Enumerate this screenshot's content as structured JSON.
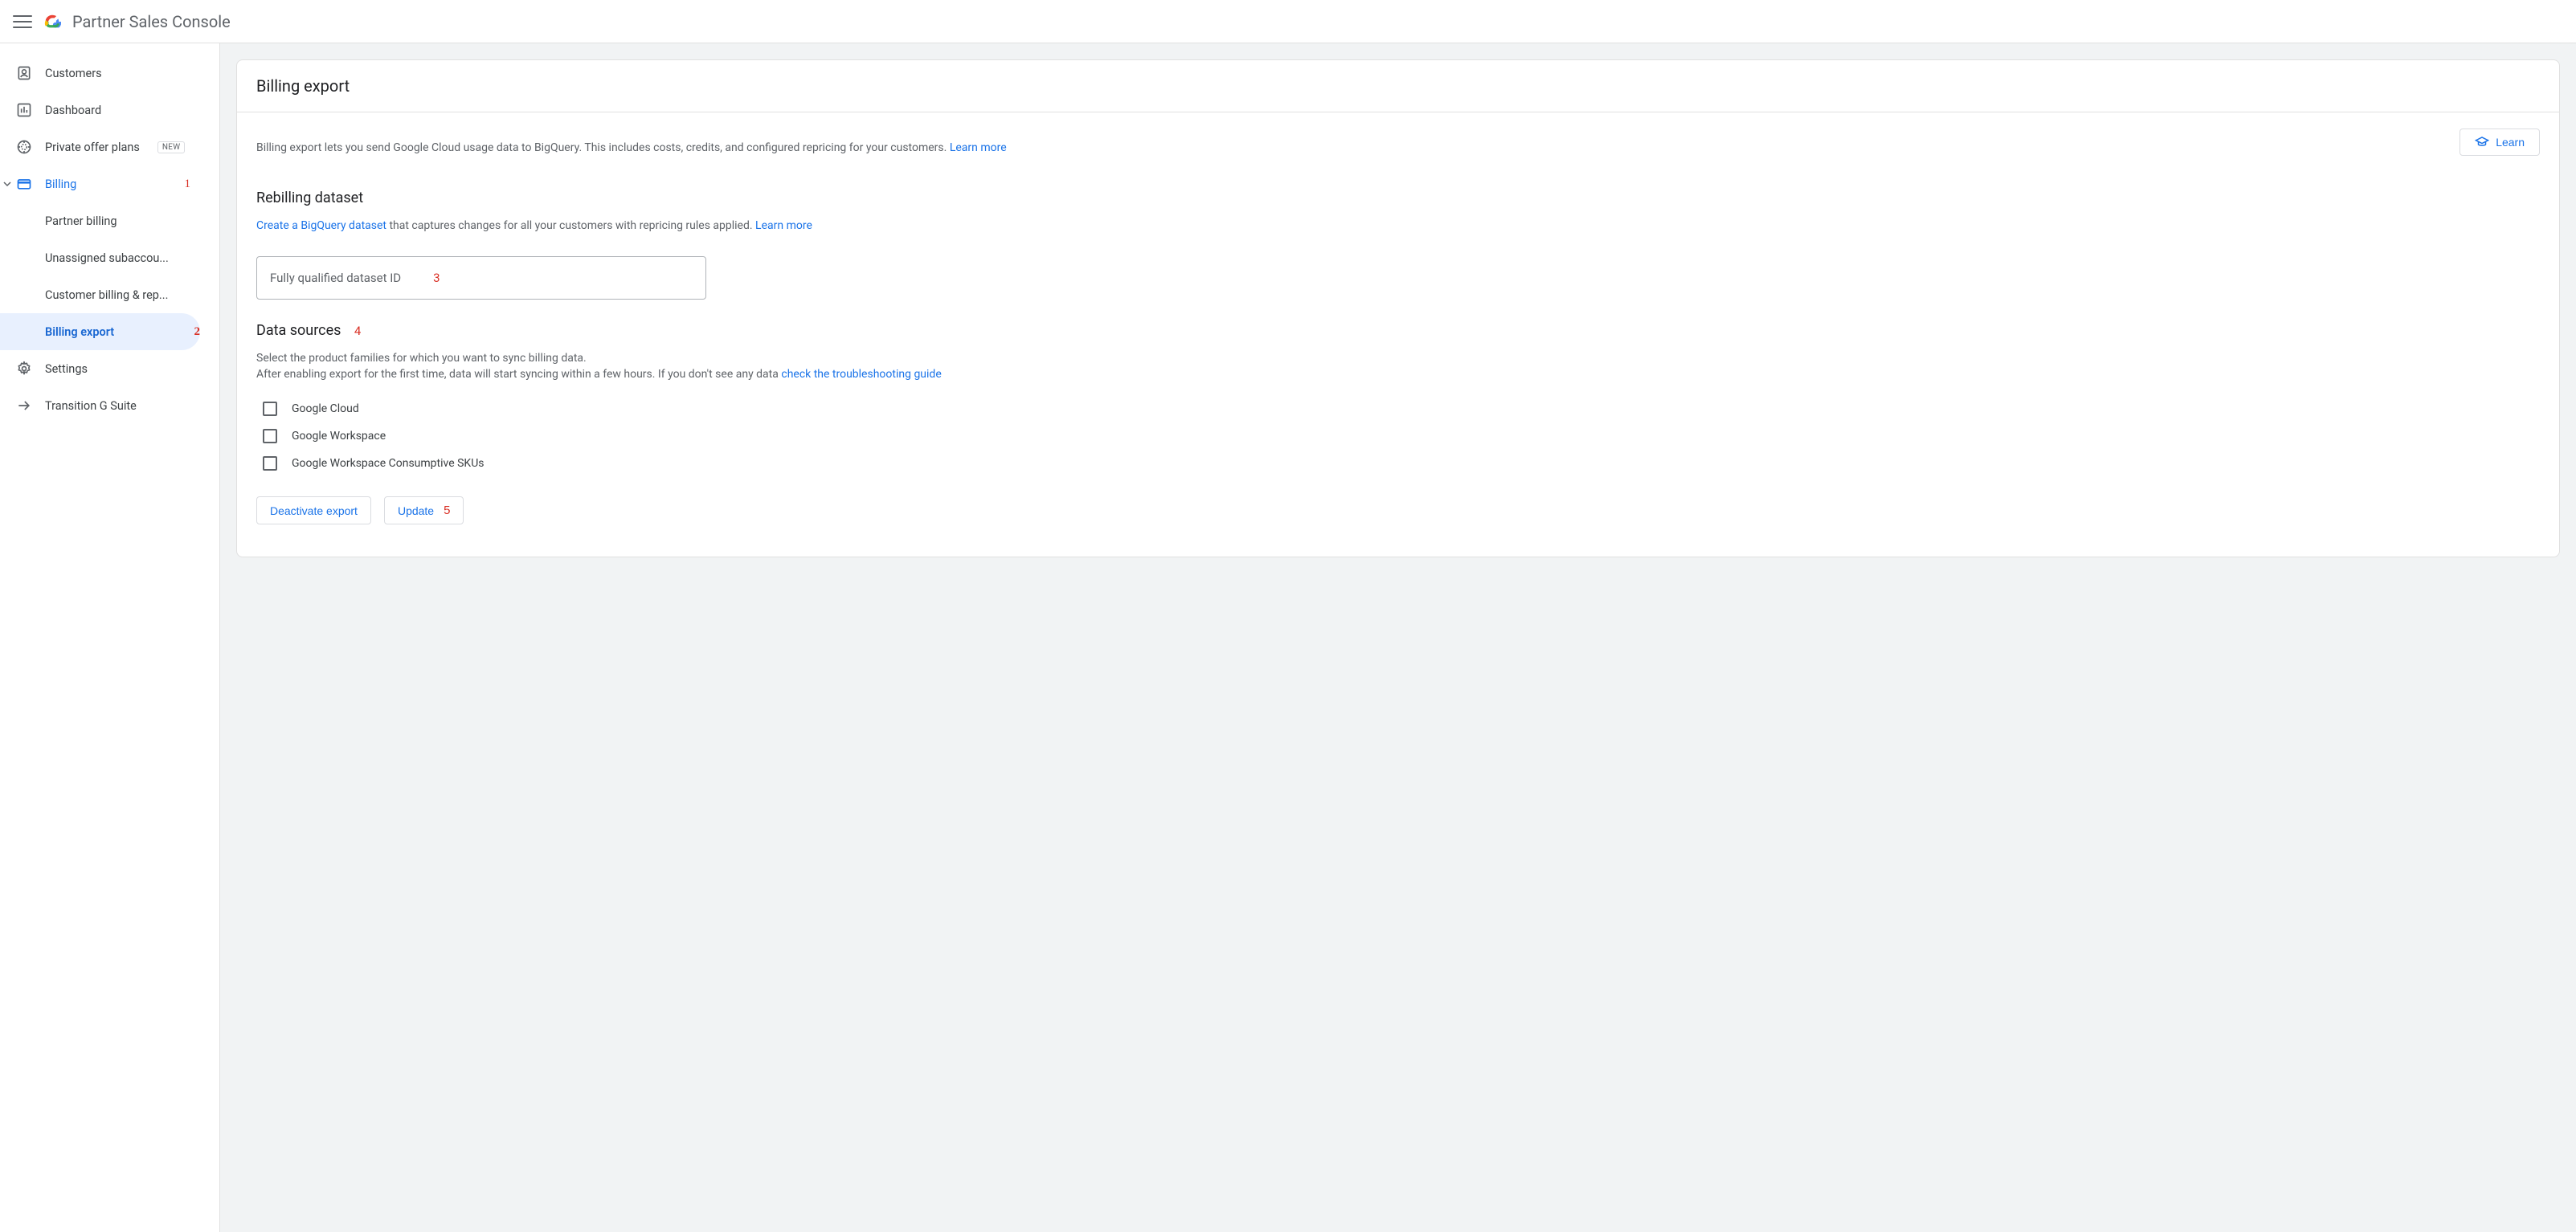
{
  "header": {
    "product_name": "Partner Sales Console"
  },
  "sidebar": {
    "items": [
      {
        "label": "Customers"
      },
      {
        "label": "Dashboard"
      },
      {
        "label": "Private offer plans",
        "badge": "NEW"
      },
      {
        "label": "Billing",
        "annot": "1"
      },
      {
        "label": "Settings"
      },
      {
        "label": "Transition G Suite"
      }
    ],
    "billing_children": [
      {
        "label": "Partner billing"
      },
      {
        "label": "Unassigned subaccou..."
      },
      {
        "label": "Customer billing & rep..."
      },
      {
        "label": "Billing export",
        "annot": "2",
        "active": true
      }
    ]
  },
  "main": {
    "title": "Billing export",
    "intro_text": "Billing export lets you send Google Cloud usage data to BigQuery. This includes costs, credits, and configured repricing for your customers. ",
    "intro_learn": "Learn more",
    "learn_btn": "Learn",
    "rebilling": {
      "heading": "Rebilling dataset",
      "link1": "Create a BigQuery dataset",
      "text_mid": " that captures changes for all your customers with repricing rules applied. ",
      "link2": "Learn more",
      "input_placeholder": "Fully qualified dataset ID",
      "input_annot": "3"
    },
    "sources": {
      "heading": "Data sources",
      "heading_annot": "4",
      "line1": "Select the product families for which you want to sync billing data.",
      "line2_a": "After enabling export for the first time, data will start syncing within a few hours. If you don't see any data ",
      "line2_link": "check the troubleshooting guide",
      "options": [
        {
          "label": "Google Cloud"
        },
        {
          "label": "Google Workspace"
        },
        {
          "label": "Google Workspace Consumptive SKUs"
        }
      ]
    },
    "actions": {
      "deactivate": "Deactivate export",
      "update": "Update",
      "update_annot": "5"
    }
  }
}
